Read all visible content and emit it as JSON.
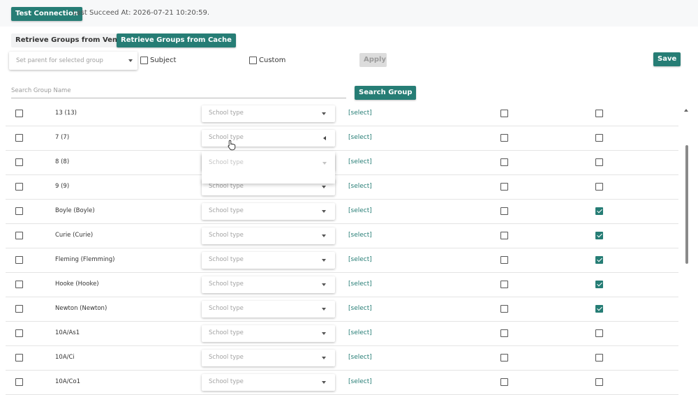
{
  "toolbar": {
    "test_connection_label": "Test Connection",
    "last_succeed_text": "Last Succeed At: 2026-07-21 10:20:59.",
    "retrieve_vendor_label": "Retrieve Groups from Vendor",
    "retrieve_cache_label": "Retrieve Groups from Cache",
    "parent_select_placeholder": "Set parent for selected group",
    "subject_label": "Subject",
    "custom_label": "Custom",
    "apply_label": "Apply",
    "save_label": "Save",
    "search_placeholder": "Search Group Name",
    "search_button_label": "Search Group"
  },
  "school_type_placeholder": "School type",
  "select_link_label": "[select]",
  "rows": [
    {
      "name": "13 (13)",
      "select_checked": false,
      "custom_checked": false,
      "subject_checked": false
    },
    {
      "name": "7 (7)",
      "select_checked": false,
      "custom_checked": false,
      "subject_checked": false
    },
    {
      "name": "8 (8)",
      "select_checked": false,
      "custom_checked": false,
      "subject_checked": false
    },
    {
      "name": "9 (9)",
      "select_checked": false,
      "custom_checked": false,
      "subject_checked": false
    },
    {
      "name": "Boyle (Boyle)",
      "select_checked": false,
      "custom_checked": false,
      "subject_checked": true
    },
    {
      "name": "Curie (Curie)",
      "select_checked": false,
      "custom_checked": false,
      "subject_checked": true
    },
    {
      "name": "Fleming (Flemming)",
      "select_checked": false,
      "custom_checked": false,
      "subject_checked": true
    },
    {
      "name": "Hooke (Hooke)",
      "select_checked": false,
      "custom_checked": false,
      "subject_checked": true
    },
    {
      "name": "Newton (Newton)",
      "select_checked": false,
      "custom_checked": false,
      "subject_checked": true
    },
    {
      "name": "10A/As1",
      "select_checked": false,
      "custom_checked": false,
      "subject_checked": false
    },
    {
      "name": "10A/Ci",
      "select_checked": false,
      "custom_checked": false,
      "subject_checked": false
    },
    {
      "name": "10A/Co1",
      "select_checked": false,
      "custom_checked": false,
      "subject_checked": false
    }
  ],
  "open_dropdown": {
    "row_index": 1
  },
  "colors": {
    "accent": "#267d75",
    "disabled": "#dcdcdc"
  }
}
